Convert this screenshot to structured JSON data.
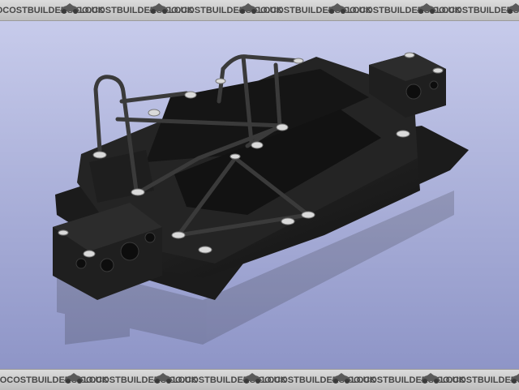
{
  "watermark": {
    "text": "LOCOSTBUILDERS.CO.UK",
    "logo": "car-silhouette-logo",
    "colors": {
      "banner": "#c8c8c8",
      "text": "#474747"
    }
  },
  "image": {
    "subject": "car-chassis-render",
    "colors": {
      "background": "#aab0d8",
      "chassis": "#1c1c1c",
      "tubes": "#2f2f2f",
      "plates": "#d8d8d8"
    }
  }
}
